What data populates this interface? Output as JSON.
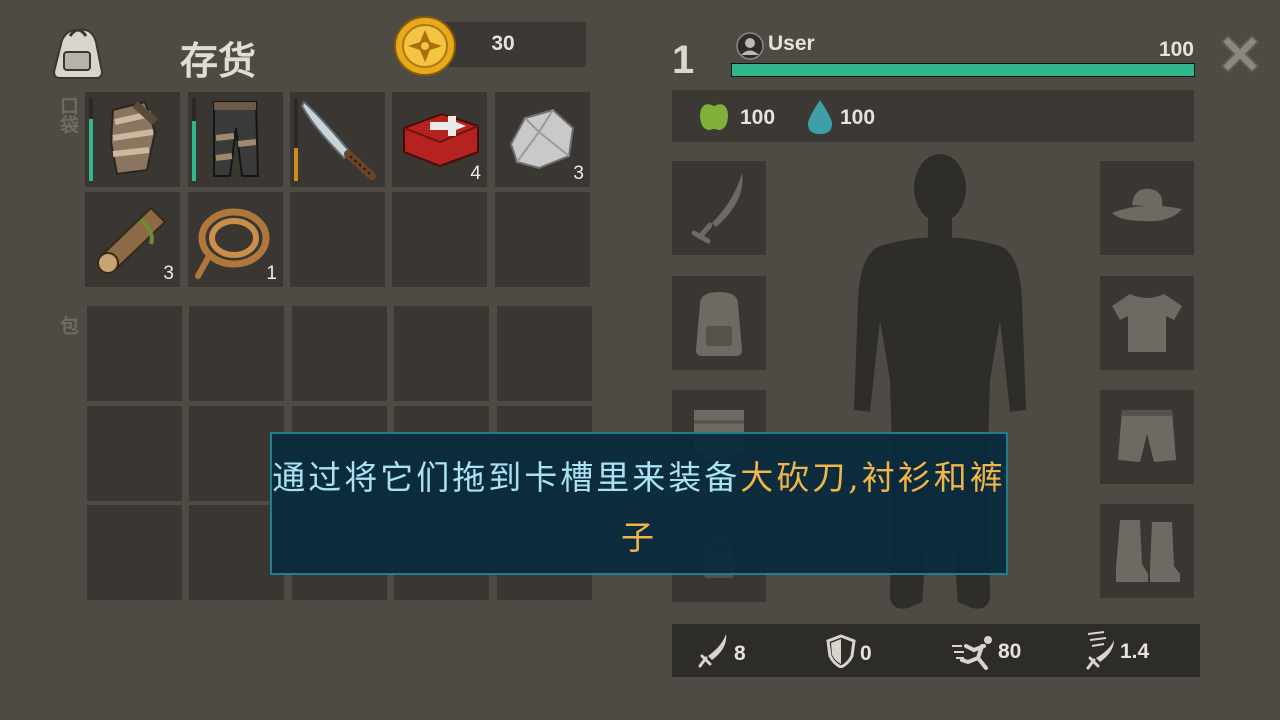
{
  "inventory": {
    "title": "存货",
    "pockets_label": "口袋",
    "bag_label": "包",
    "coins": "30",
    "pocket_items": [
      {
        "name": "bandage-torso-icon",
        "count": "",
        "durability": 0.75,
        "bar_color": "#2fb88e"
      },
      {
        "name": "pants-icon",
        "count": "",
        "durability": 0.72,
        "bar_color": "#2fb88e"
      },
      {
        "name": "machete-icon",
        "count": "",
        "durability": 0.4,
        "bar_color": "#d08a1e"
      },
      {
        "name": "first-aid-kit-icon",
        "count": "4"
      },
      {
        "name": "stone-icon",
        "count": "3"
      },
      {
        "name": "wood-log-icon",
        "count": "3"
      },
      {
        "name": "rope-icon",
        "count": "1"
      }
    ]
  },
  "player": {
    "level": "1",
    "name": "User",
    "health": "100",
    "health_fraction": 1.0,
    "food": "100",
    "water": "100"
  },
  "stats": {
    "attack": "8",
    "armor": "0",
    "speed": "80",
    "attack_speed": "1.4"
  },
  "tooltip": {
    "part1": "通过将它们拖到卡槽里来装备",
    "part2": "大砍刀,",
    "part3": "衬衫和裤子"
  },
  "colors": {
    "background": "#4e4a44",
    "slot": "#3a3733",
    "health_bar": "#2fb88e",
    "tooltip_bg": "#0a2a3e",
    "tooltip_text": "#a9e3f2",
    "tooltip_highlight": "#f1b64a"
  }
}
